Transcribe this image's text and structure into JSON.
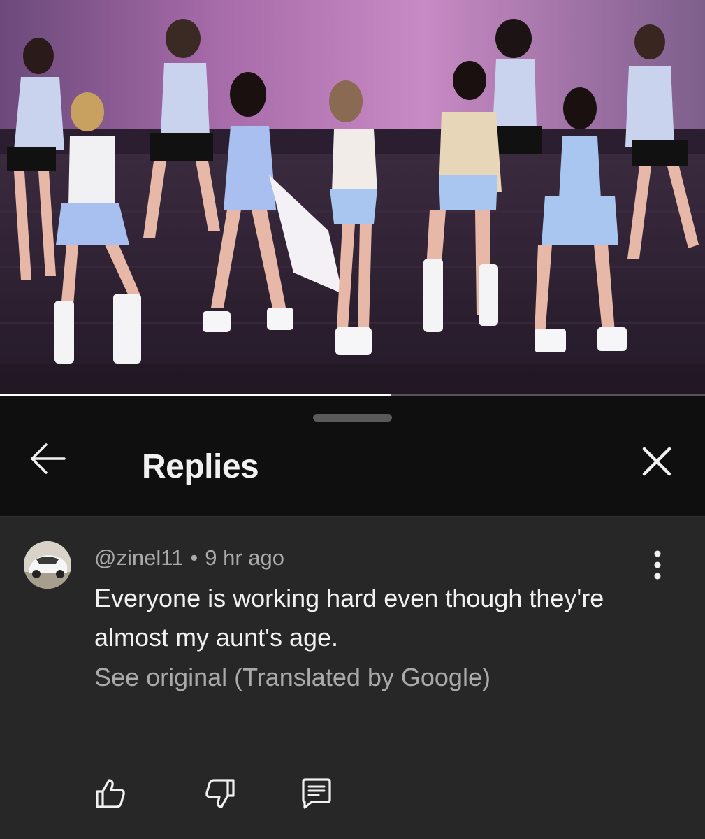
{
  "video": {
    "thumbnail_icon": "concert-stage-image",
    "progress": 0.555
  },
  "sheet": {
    "title": "Replies",
    "back_icon": "arrow-left-icon",
    "close_icon": "close-icon"
  },
  "comment": {
    "author": "@zinel11",
    "separator": "•",
    "time": "9 hr ago",
    "text": "Everyone is working hard even though they're almost my aunt's age.",
    "see_original": "See original (Translated by Google)",
    "avatar_icon": "white-car-avatar",
    "more_icon": "more-vert-icon",
    "actions": {
      "like_icon": "thumbs-up-icon",
      "dislike_icon": "thumbs-down-icon",
      "reply_icon": "reply-icon"
    }
  },
  "colors": {
    "background": "#0f0f0f",
    "comment_background": "#272727",
    "primary_text": "#f1f1f1",
    "secondary_text": "#aaaaaa"
  }
}
